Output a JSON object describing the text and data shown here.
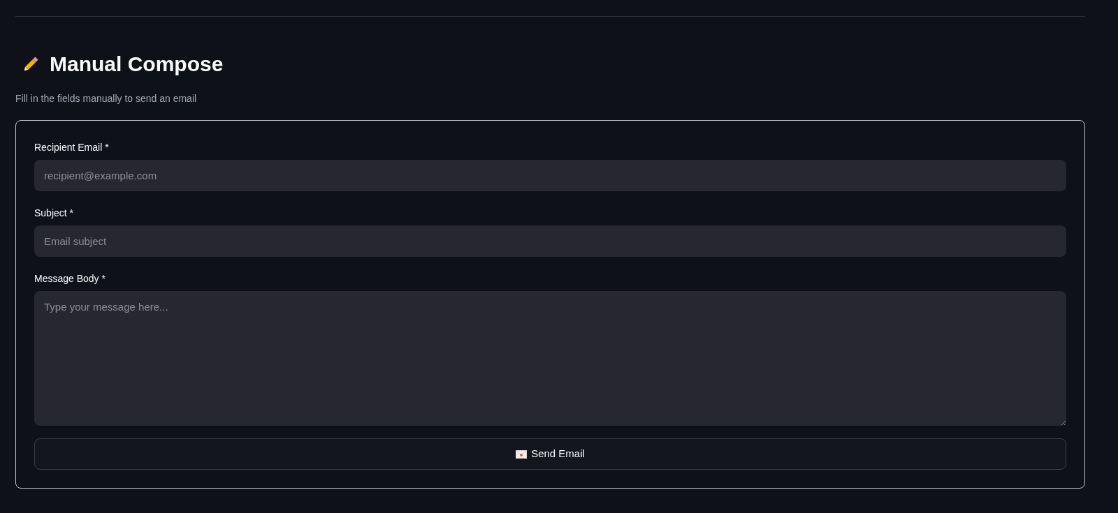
{
  "header": {
    "title": "Manual Compose",
    "subtitle": "Fill in the fields manually to send an email"
  },
  "form": {
    "fields": [
      {
        "kind": "input",
        "label": "Recipient Email *",
        "placeholder": "recipient@example.com"
      },
      {
        "kind": "input",
        "label": "Subject *",
        "placeholder": "Email subject"
      },
      {
        "kind": "textarea",
        "label": "Message Body *",
        "placeholder": "Type your message here..."
      }
    ],
    "submit_button": {
      "label": "Send Email"
    }
  }
}
